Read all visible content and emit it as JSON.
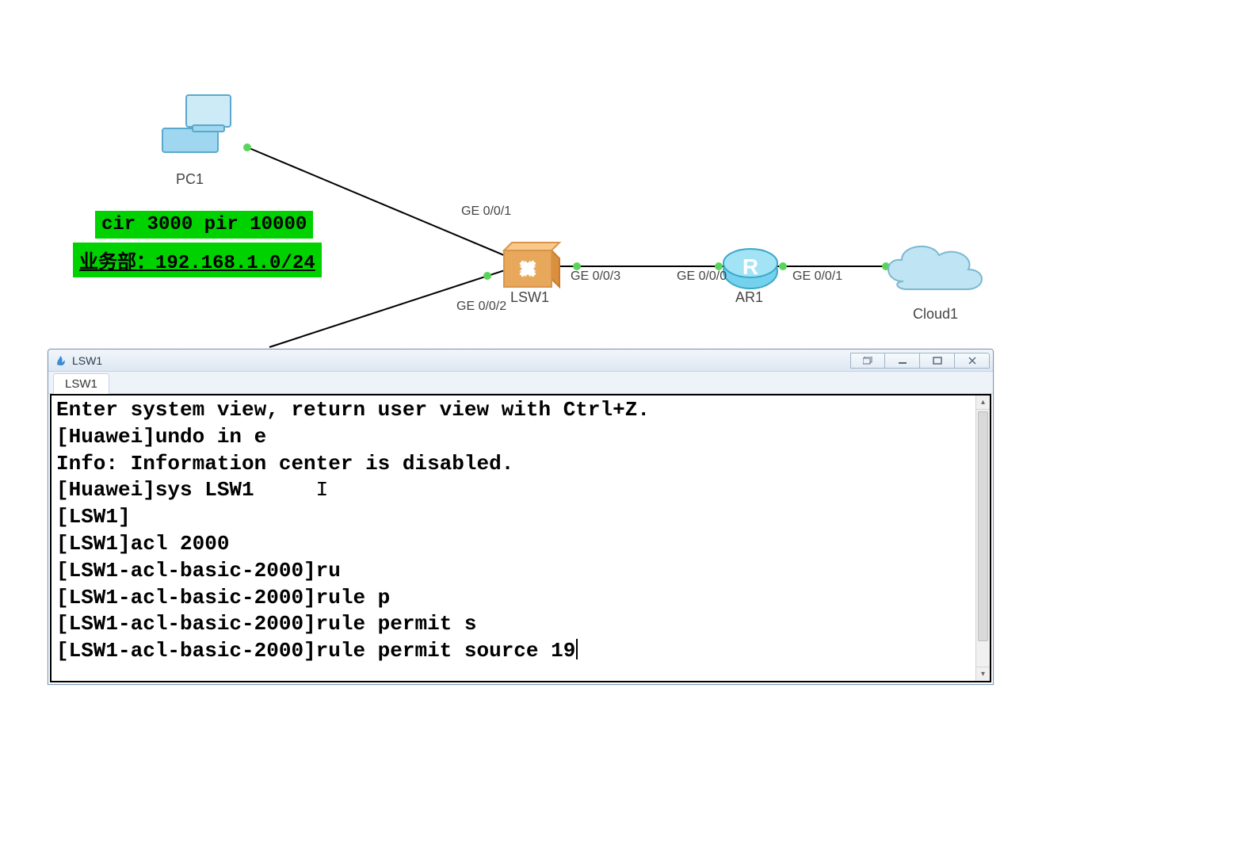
{
  "topology": {
    "nodes": {
      "pc1": {
        "label": "PC1"
      },
      "lsw1": {
        "label": "LSW1"
      },
      "ar1": {
        "label": "AR1"
      },
      "cloud1": {
        "label": "Cloud1"
      }
    },
    "port_labels": {
      "lsw1_ge001": "GE 0/0/1",
      "lsw1_ge002": "GE 0/0/2",
      "lsw1_ge003": "GE 0/0/3",
      "ar1_ge000": "GE 0/0/0",
      "ar1_ge001": "GE 0/0/1"
    },
    "annotations": {
      "rate_limit": "cir 3000 pir 10000",
      "subnet": "业务部：192.168.1.0/24"
    }
  },
  "terminal": {
    "window_title": "LSW1",
    "tab_label": "LSW1",
    "lines": [
      "Enter system view, return user view with Ctrl+Z.",
      "[Huawei]undo in e",
      "Info: Information center is disabled.",
      "[Huawei]sys LSW1",
      "[LSW1]",
      "[LSW1]acl 2000",
      "[LSW1-acl-basic-2000]ru",
      "[LSW1-acl-basic-2000]rule p",
      "[LSW1-acl-basic-2000]rule permit s",
      "[LSW1-acl-basic-2000]rule permit source 19"
    ],
    "mouse_cursor_after_line_index": 3
  }
}
